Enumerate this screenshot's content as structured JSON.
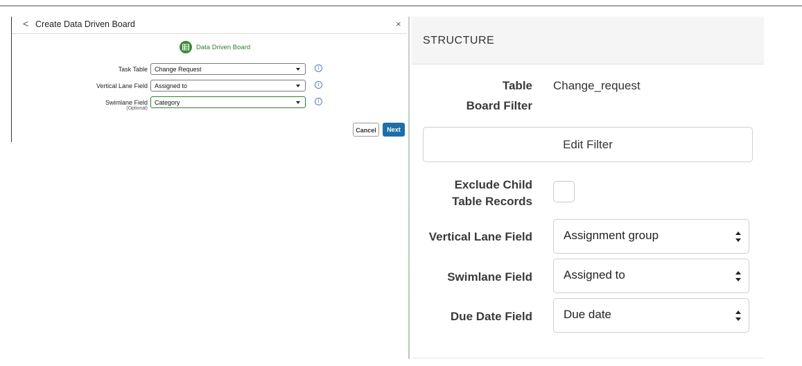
{
  "dialog": {
    "title": "Create Data Driven Board",
    "back_glyph": "<",
    "close_glyph": "×",
    "badge_label": "Data Driven Board",
    "fields": [
      {
        "label": "Task Table",
        "sublabel": "",
        "value": "Change Request",
        "focused": false
      },
      {
        "label": "Vertical Lane Field",
        "sublabel": "",
        "value": "Assigned to",
        "focused": false
      },
      {
        "label": "Swimlane Field",
        "sublabel": "(Optional)",
        "value": "Category",
        "focused": true
      }
    ],
    "info_glyph": "i",
    "cancel_label": "Cancel",
    "next_label": "Next",
    "accent_green": "#2e7d32",
    "button_blue": "#1d6fa5"
  },
  "structure": {
    "title": "STRUCTURE",
    "table_label": "Table",
    "table_value": "Change_request",
    "board_filter_label": "Board Filter",
    "edit_filter_label": "Edit Filter",
    "exclude_label_line1": "Exclude Child",
    "exclude_label_line2": "Table Records",
    "exclude_checked": false,
    "vertical_lane_label": "Vertical Lane Field",
    "vertical_lane_value": "Assignment group",
    "swimlane_label": "Swimlane Field",
    "swimlane_value": "Assigned to",
    "due_date_label": "Due Date Field",
    "due_date_value": "Due date"
  }
}
